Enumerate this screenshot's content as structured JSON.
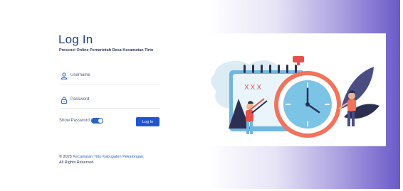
{
  "login": {
    "title": "Log In",
    "subtitle": "Presensi Online Pemerintah Desa Kecamatan Tirto",
    "username_placeholder": "Username",
    "password_placeholder": "Password",
    "show_password_label": "Show Password",
    "show_password_on": true,
    "submit_label": "Log In"
  },
  "footer": {
    "copyright_prefix": "© 2025",
    "organization": "Kecamatan Tirto Kabupaten Pekalongan.",
    "rights": "All Rights Reserved."
  },
  "illustration": {
    "alarm_marks": "XXX"
  },
  "colors": {
    "primary": "#1f56d0",
    "heading": "#1f3f8a",
    "gradient_end": "#6a59c9"
  }
}
